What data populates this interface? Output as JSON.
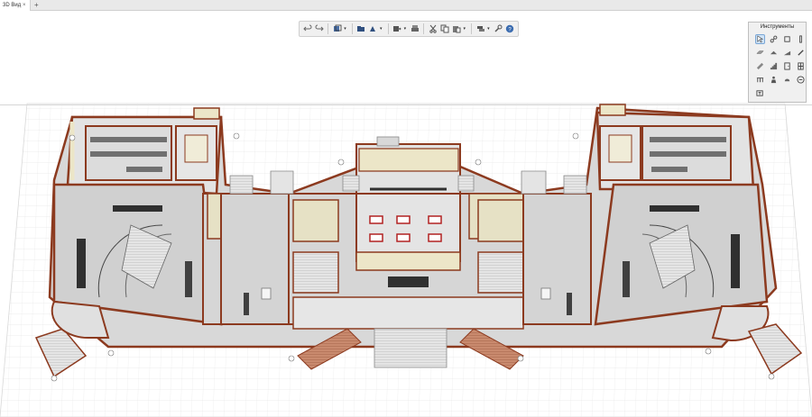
{
  "tabs": [
    {
      "label": "3D Вид",
      "close": "×"
    }
  ],
  "new_tab": "+",
  "toolbar": {
    "buttons": [
      "undo-icon",
      "redo-icon",
      "view-cube-icon",
      "open-folder-icon",
      "print-setup-icon",
      "export-icon",
      "print-icon",
      "cut-icon",
      "copy-icon",
      "paste-icon",
      "layers-icon",
      "settings-wrench-icon",
      "help-icon"
    ]
  },
  "tools_panel": {
    "title": "Инструменты",
    "tools": [
      "pointer-icon",
      "measure-icon",
      "wall-icon",
      "column-icon",
      "slab-icon",
      "roof-icon",
      "wedge-icon",
      "pencil-icon",
      "beam-icon",
      "stair-icon",
      "door-icon",
      "window-icon",
      "railing-icon",
      "person-icon",
      "object-icon",
      "dimension-icon",
      "text-tag-icon"
    ]
  },
  "colors": {
    "wall_top": "#8c3a1f",
    "wall_face": "#ece6c8",
    "floor": "#d9d9d9",
    "grid": "#e4e4e4",
    "chairs_red": "#b22222",
    "stairs": "#b97356",
    "background": "#ffffff"
  }
}
